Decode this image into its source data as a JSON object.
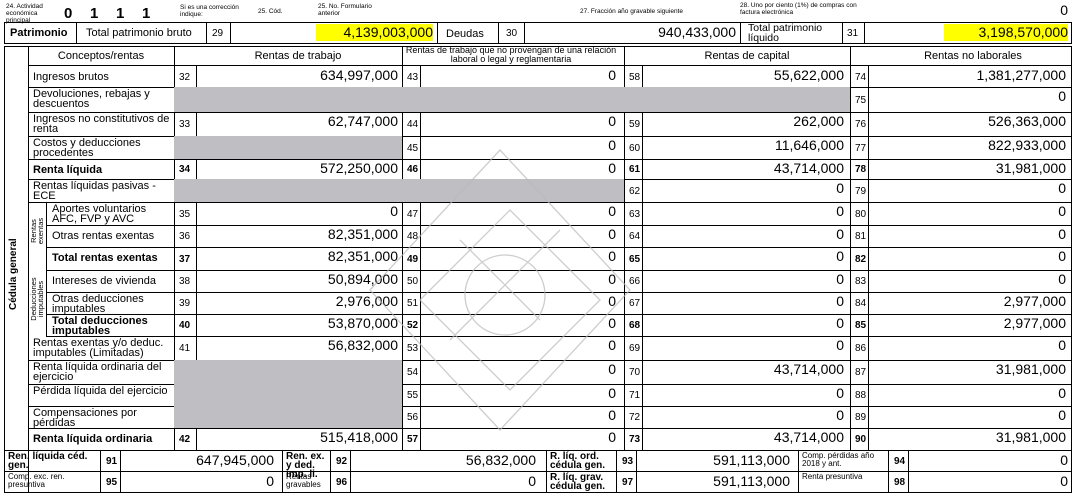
{
  "top": {
    "f24": "24. Actividad económica principal",
    "act_digits": [
      "0",
      "1",
      "1",
      "1"
    ],
    "corr": "Si es una corrección indique:",
    "cod": "25. Cód.",
    "form_prev": "25. No. Formulario anterior",
    "frac": "27. Fracción año gravable siguiente",
    "uno_pct": "28. Uno por ciento (1%) de compras con factura electrónica",
    "uno_val": "0"
  },
  "patr": {
    "title": "Patrimonio",
    "bruto_label": "Total patrimonio bruto",
    "bruto_code": "29",
    "bruto_val": "4,139,003,000",
    "deudas_label": "Deudas",
    "deudas_code": "30",
    "deudas_val": "940,433,000",
    "liq_label": "Total patrimonio líquido",
    "liq_code": "31",
    "liq_val": "3,198,570,000"
  },
  "headers": {
    "conceptos": "Conceptos/rentas",
    "trabajo": "Rentas de trabajo",
    "no_laboral": "Rentas de trabajo que no provengan de una relación laboral o legal y reglamentaria",
    "capital": "Rentas de capital",
    "no_laborales": "Rentas no laborales"
  },
  "side": {
    "cedula": "Cédula general",
    "exentas": "Rentas exentas",
    "deducciones": "Deducciones imputables"
  },
  "rows": [
    {
      "label": "Ingresos brutos",
      "c1": "32",
      "v1": "634,997,000",
      "c2": "43",
      "v2": "0",
      "c3": "58",
      "v3": "55,622,000",
      "c4": "74",
      "v4": "1,381,277,000"
    },
    {
      "label": "Devoluciones, rebajas y descuentos",
      "c4": "75",
      "v4": "0"
    },
    {
      "label": "Ingresos no constitutivos de renta",
      "c1": "33",
      "v1": "62,747,000",
      "c2": "44",
      "v2": "0",
      "c3": "59",
      "v3": "262,000",
      "c4": "76",
      "v4": "526,363,000"
    },
    {
      "label": "Costos y deducciones procedentes",
      "c2": "45",
      "v2": "0",
      "c3": "60",
      "v3": "11,646,000",
      "c4": "77",
      "v4": "822,933,000"
    },
    {
      "label": "Renta líquida",
      "c1": "34",
      "v1": "572,250,000",
      "c2": "46",
      "v2": "0",
      "c3": "61",
      "v3": "43,714,000",
      "c4": "78",
      "v4": "31,981,000"
    },
    {
      "label": "Rentas líquidas pasivas - ECE",
      "c3": "62",
      "v3": "0",
      "c4": "79",
      "v4": "0"
    },
    {
      "label": "Aportes voluntarios AFC, FVP y AVC",
      "c1": "35",
      "v1": "0",
      "c2": "47",
      "v2": "0",
      "c3": "63",
      "v3": "0",
      "c4": "80",
      "v4": "0"
    },
    {
      "label": "Otras rentas exentas",
      "c1": "36",
      "v1": "82,351,000",
      "c2": "48",
      "v2": "0",
      "c3": "64",
      "v3": "0",
      "c4": "81",
      "v4": "0"
    },
    {
      "label": "Total rentas exentas",
      "c1": "37",
      "v1": "82,351,000",
      "c2": "49",
      "v2": "0",
      "c3": "65",
      "v3": "0",
      "c4": "82",
      "v4": "0"
    },
    {
      "label": "Intereses de vivienda",
      "c1": "38",
      "v1": "50,894,000",
      "c2": "50",
      "v2": "0",
      "c3": "66",
      "v3": "0",
      "c4": "83",
      "v4": "0"
    },
    {
      "label": "Otras deducciones imputables",
      "c1": "39",
      "v1": "2,976,000",
      "c2": "51",
      "v2": "0",
      "c3": "67",
      "v3": "0",
      "c4": "84",
      "v4": "2,977,000"
    },
    {
      "label": "Total deducciones imputables",
      "c1": "40",
      "v1": "53,870,000",
      "c2": "52",
      "v2": "0",
      "c3": "68",
      "v3": "0",
      "c4": "85",
      "v4": "2,977,000"
    },
    {
      "label": "Rentas exentas y/o deduc. imputables (Limitadas)",
      "c1": "41",
      "v1": "56,832,000",
      "c2": "53",
      "v2": "0",
      "c3": "69",
      "v3": "0",
      "c4": "86",
      "v4": "0"
    },
    {
      "label": "Renta líquida ordinaria del ejercicio",
      "c2": "54",
      "v2": "0",
      "c3": "70",
      "v3": "43,714,000",
      "c4": "87",
      "v4": "31,981,000"
    },
    {
      "label": "Pérdida líquida del ejercicio",
      "c2": "55",
      "v2": "0",
      "c3": "71",
      "v3": "0",
      "c4": "88",
      "v4": "0"
    },
    {
      "label": "Compensaciones por pérdidas",
      "c2": "56",
      "v2": "0",
      "c3": "72",
      "v3": "0",
      "c4": "89",
      "v4": "0"
    },
    {
      "label": "Renta líquida ordinaria",
      "c1": "42",
      "v1": "515,418,000",
      "c2": "57",
      "v2": "0",
      "c3": "73",
      "v3": "43,714,000",
      "c4": "90",
      "v4": "31,981,000"
    }
  ],
  "bottom": {
    "r1": [
      {
        "label": "Ren. líquida céd. gen.",
        "code": "91",
        "val": "647,945,000"
      },
      {
        "label": "Ren. ex. y ded. imp. li.",
        "code": "92",
        "val": "56,832,000"
      },
      {
        "label": "R. líq. ord. cédula gen.",
        "code": "93",
        "val": "591,113,000"
      },
      {
        "label": "Comp. pérdidas año 2018 y ant.",
        "code": "94",
        "val": "0"
      }
    ],
    "r2": [
      {
        "label": "Comp. exc. ren. presuntiva",
        "code": "95",
        "val": "0"
      },
      {
        "label": "Rentas gravables",
        "code": "96",
        "val": "0"
      },
      {
        "label": "R. líq. grav. cédula gen.",
        "code": "97",
        "val": "591,113,000"
      },
      {
        "label": "Renta presuntiva",
        "code": "98",
        "val": "0"
      }
    ]
  },
  "colors": {
    "shade": "#bfbfc3",
    "highlight": "#ffff00"
  }
}
